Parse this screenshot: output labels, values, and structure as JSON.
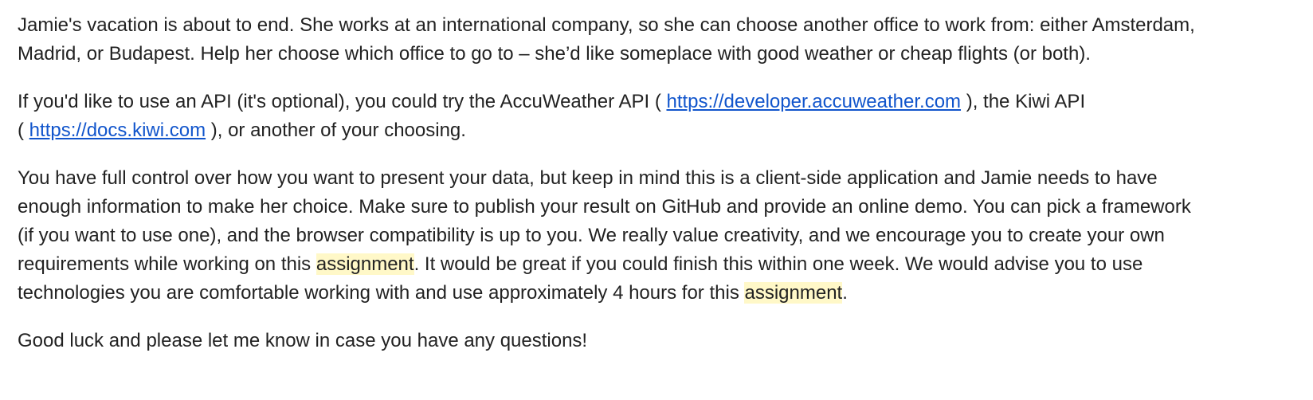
{
  "paragraphs": {
    "p1": {
      "line1": "Jamie's vacation is about to end. She works at an international company, so she can choose another office to work from: either Amsterdam,",
      "line2": "Madrid, or Budapest. Help her choose which office to go to – she’d like someplace with good weather or cheap flights (or both)."
    },
    "p2": {
      "line1_before": "If you'd like to use an API (it's optional), you could try the AccuWeather API ( ",
      "link_accuweather": "https://developer.accuweather.com",
      "line1_after": " ), the Kiwi API",
      "line2_before": "( ",
      "link_kiwi": "https://docs.kiwi.com",
      "line2_after": " ), or another of your choosing."
    },
    "p3": {
      "line1": "You have full control over how you want to present your data, but keep in mind this is a client-side application and Jamie needs to have",
      "line2": "enough information to make her choice. Make sure to publish your result on GitHub and provide an online demo. You can pick a framework",
      "line3": "(if you want to use one), and the browser compatibility is up to you. We really value creativity, and we encourage you to create your own",
      "line4_before": "requirements while working on this ",
      "highlight_word": "assignment",
      "line4_after": ". It would be great if you could finish this within one week. We would advise you to use",
      "line5_before": "technologies you are comfortable working with and use approximately 4 hours for this ",
      "line5_after": "."
    },
    "p4": {
      "line1": "Good luck and please let me know in case you have any questions!"
    }
  },
  "colors": {
    "text": "#222222",
    "link": "#1155cc",
    "highlight": "#fff8c8"
  }
}
